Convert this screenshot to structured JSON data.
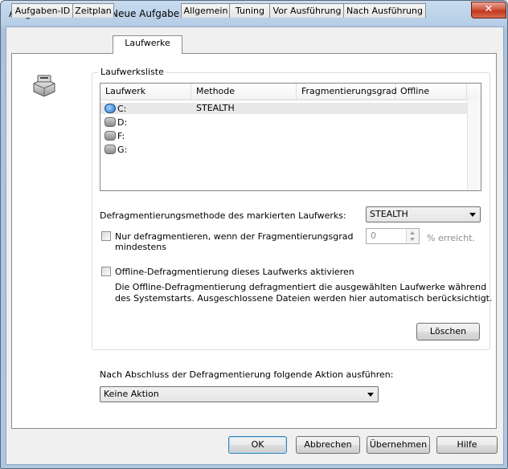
{
  "window": {
    "title": "Aufgabe bearbeiten: Neue Aufgabe",
    "close_symbol": "✕"
  },
  "tabs": [
    {
      "label": "Aufgaben-ID",
      "active": false
    },
    {
      "label": "Zeitplan",
      "active": false
    },
    {
      "label": "Laufwerke",
      "active": true
    },
    {
      "label": "Allgemein",
      "active": false
    },
    {
      "label": "Tuning",
      "active": false
    },
    {
      "label": "Vor Ausführung",
      "active": false
    },
    {
      "label": "Nach Ausführung",
      "active": false
    }
  ],
  "drives_group": {
    "label": "Laufwerksliste",
    "columns": [
      "Laufwerk",
      "Methode",
      "Fragmentierungsgrad",
      "Offline"
    ],
    "rows": [
      {
        "drive": "C:",
        "method": "STEALTH",
        "fragmentation": "",
        "offline": "",
        "icon": "system-drive-icon",
        "selected": true
      },
      {
        "drive": "D:",
        "method": "",
        "fragmentation": "",
        "offline": "",
        "icon": "drive-icon",
        "selected": false
      },
      {
        "drive": "F:",
        "method": "",
        "fragmentation": "",
        "offline": "",
        "icon": "drive-icon",
        "selected": false
      },
      {
        "drive": "G:",
        "method": "",
        "fragmentation": "",
        "offline": "",
        "icon": "drive-icon",
        "selected": false
      }
    ],
    "method_label": "Defragmentierungsmethode des markierten Laufwerks:",
    "method_value": "STEALTH",
    "only_defrag_label_line1": "Nur defragmentieren, wenn der Fragmentierungsgrad",
    "only_defrag_label_line2": "mindestens",
    "only_defrag_checked": false,
    "threshold_value": "0",
    "threshold_suffix": "% erreicht.",
    "offline_label": "Offline-Defragmentierung dieses Laufwerks aktivieren",
    "offline_checked": false,
    "offline_desc_line1": "Die Offline-Defragmentierung defragmentiert die ausgewählten Laufwerke während",
    "offline_desc_line2": "des Systemstarts. Ausgeschlossene Dateien werden hier automatisch berücksichtigt.",
    "delete_button": "Löschen"
  },
  "after_action": {
    "label": "Nach Abschluss der Defragmentierung folgende Aktion ausführen:",
    "value": "Keine Aktion"
  },
  "footer": {
    "ok": "OK",
    "cancel": "Abbrechen",
    "apply": "Übernehmen",
    "help": "Hilfe"
  }
}
